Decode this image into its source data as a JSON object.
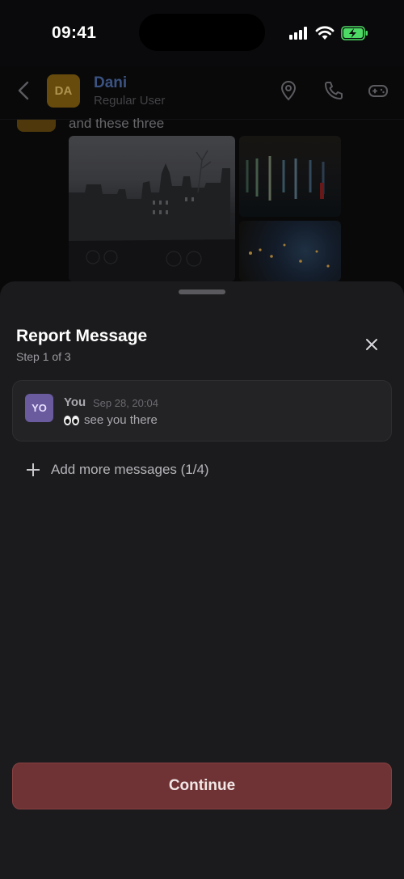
{
  "status_bar": {
    "time": "09:41"
  },
  "chat_header": {
    "avatar_initials": "DA",
    "name": "Dani",
    "subtitle": "Regular User",
    "icons": [
      "back-icon",
      "location-pin-icon",
      "phone-icon",
      "gamepad-icon"
    ]
  },
  "chat": {
    "visible_text": "and these three"
  },
  "sheet": {
    "title": "Report Message",
    "step": "Step 1 of 3",
    "message": {
      "avatar_initials": "YO",
      "author": "You",
      "timestamp": "Sep 28, 20:04",
      "emoji": "eyes",
      "text": "see you there"
    },
    "add_more_label": "Add more messages (1/4)",
    "continue_label": "Continue"
  },
  "colors": {
    "continue_button": "#6f3335",
    "contact_name": "#4f6fae",
    "you_avatar": "#6a5a9e",
    "dani_avatar": "#8a6410"
  }
}
